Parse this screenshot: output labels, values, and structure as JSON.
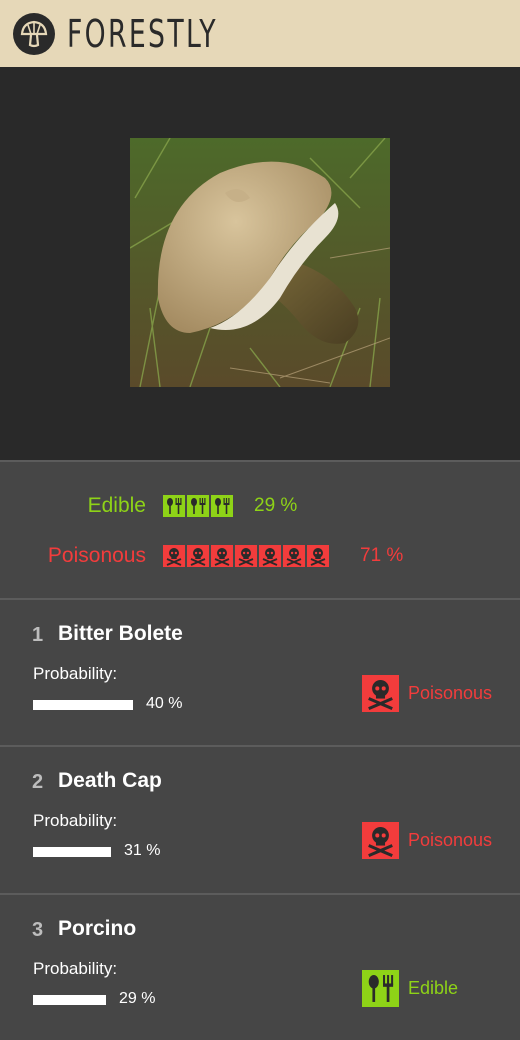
{
  "app": {
    "title": "FORESTLY"
  },
  "photo": {
    "icon": "mushroom-photo"
  },
  "summary": {
    "edible": {
      "label": "Edible",
      "percent_text": "29 %",
      "icons": 3,
      "color": "#8ed317"
    },
    "poisonous": {
      "label": "Poisonous",
      "percent_text": "71 %",
      "icons": 7,
      "color": "#f23c3c"
    }
  },
  "results": [
    {
      "rank": "1",
      "name": "Bitter Bolete",
      "prob_label": "Probability:",
      "probability": 0.4,
      "prob_text": "40 %",
      "status": "Poisonous",
      "icon": "skull-crossbones-icon"
    },
    {
      "rank": "2",
      "name": "Death Cap",
      "prob_label": "Probability:",
      "probability": 0.31,
      "prob_text": "31 %",
      "status": "Poisonous",
      "icon": "skull-crossbones-icon"
    },
    {
      "rank": "3",
      "name": "Porcino",
      "prob_label": "Probability:",
      "probability": 0.29,
      "prob_text": "29 %",
      "status": "Edible",
      "icon": "spoon-fork-icon"
    }
  ]
}
